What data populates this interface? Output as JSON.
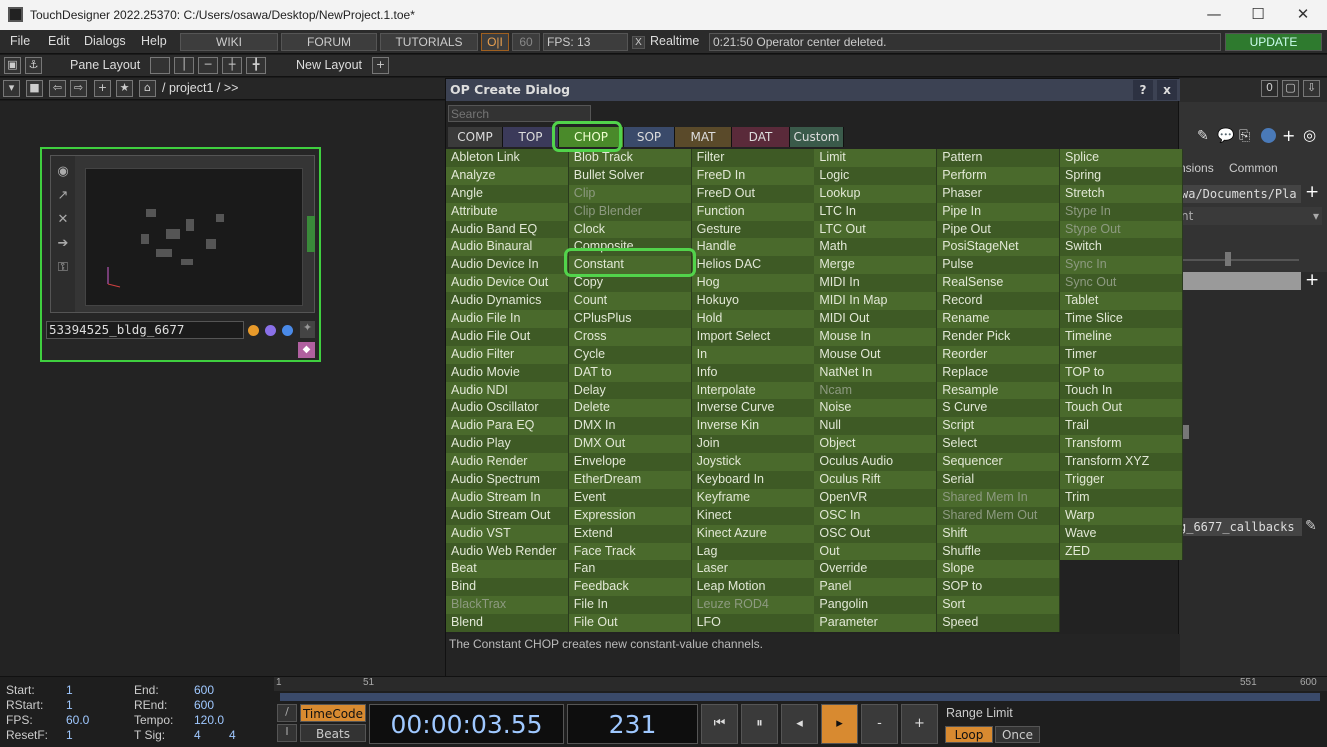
{
  "window": {
    "title": "TouchDesigner 2022.25370: C:/Users/osawa/Desktop/NewProject.1.toe*",
    "min": "—",
    "max": "☐",
    "close": "✕"
  },
  "menubar": {
    "file": "File",
    "edit": "Edit",
    "dialogs": "Dialogs",
    "help": "Help",
    "wiki": "WIKI",
    "forum": "FORUM",
    "tutorials": "TUTORIALS",
    "oi": "O|I",
    "fps_cap": "60",
    "fps_label": "FPS:",
    "fps_value": "13",
    "realtime": "Realtime",
    "message": "0:21:50 Operator center deleted.",
    "update": "UPDATE",
    "realtime_check": "X"
  },
  "toolbar": {
    "pane_layout": "Pane Layout",
    "new_layout": "New Layout",
    "plus": "+"
  },
  "pathbar": {
    "path": "/ project1 / >>"
  },
  "node": {
    "name": "53394525_bldg_6677"
  },
  "dialog": {
    "title": "OP Create Dialog",
    "help": "?",
    "close": "x",
    "search_placeholder": "Search",
    "families": [
      "COMP",
      "TOP",
      "CHOP",
      "SOP",
      "MAT",
      "DAT",
      "Custom"
    ],
    "status": "The Constant CHOP creates new constant-value channels."
  },
  "columns": [
    [
      {
        "n": "Ableton Link"
      },
      {
        "n": "Analyze"
      },
      {
        "n": "Angle"
      },
      {
        "n": "Attribute"
      },
      {
        "n": "Audio Band EQ"
      },
      {
        "n": "Audio Binaural"
      },
      {
        "n": "Audio Device In"
      },
      {
        "n": "Audio Device Out"
      },
      {
        "n": "Audio Dynamics"
      },
      {
        "n": "Audio File In"
      },
      {
        "n": "Audio File Out"
      },
      {
        "n": "Audio Filter"
      },
      {
        "n": "Audio Movie"
      },
      {
        "n": "Audio NDI"
      },
      {
        "n": "Audio Oscillator"
      },
      {
        "n": "Audio Para EQ"
      },
      {
        "n": "Audio Play"
      },
      {
        "n": "Audio Render"
      },
      {
        "n": "Audio Spectrum"
      },
      {
        "n": "Audio Stream In"
      },
      {
        "n": "Audio Stream Out"
      },
      {
        "n": "Audio VST"
      },
      {
        "n": "Audio Web Render"
      },
      {
        "n": "Beat"
      },
      {
        "n": "Bind"
      },
      {
        "n": "BlackTrax",
        "d": 1
      },
      {
        "n": "Blend"
      }
    ],
    [
      {
        "n": "Blob Track"
      },
      {
        "n": "Bullet Solver"
      },
      {
        "n": "Clip",
        "d": 1
      },
      {
        "n": "Clip Blender",
        "d": 1
      },
      {
        "n": "Clock"
      },
      {
        "n": "Composite"
      },
      {
        "n": "Constant"
      },
      {
        "n": "Copy"
      },
      {
        "n": "Count"
      },
      {
        "n": "CPlusPlus"
      },
      {
        "n": "Cross"
      },
      {
        "n": "Cycle"
      },
      {
        "n": "DAT to"
      },
      {
        "n": "Delay"
      },
      {
        "n": "Delete"
      },
      {
        "n": "DMX In"
      },
      {
        "n": "DMX Out"
      },
      {
        "n": "Envelope"
      },
      {
        "n": "EtherDream"
      },
      {
        "n": "Event"
      },
      {
        "n": "Expression"
      },
      {
        "n": "Extend"
      },
      {
        "n": "Face Track"
      },
      {
        "n": "Fan"
      },
      {
        "n": "Feedback"
      },
      {
        "n": "File In"
      },
      {
        "n": "File Out"
      }
    ],
    [
      {
        "n": "Filter"
      },
      {
        "n": "FreeD In"
      },
      {
        "n": "FreeD Out"
      },
      {
        "n": "Function"
      },
      {
        "n": "Gesture"
      },
      {
        "n": "Handle"
      },
      {
        "n": "Helios DAC"
      },
      {
        "n": "Hog"
      },
      {
        "n": "Hokuyo"
      },
      {
        "n": "Hold"
      },
      {
        "n": "Import Select"
      },
      {
        "n": "In"
      },
      {
        "n": "Info"
      },
      {
        "n": "Interpolate"
      },
      {
        "n": "Inverse Curve"
      },
      {
        "n": "Inverse Kin"
      },
      {
        "n": "Join"
      },
      {
        "n": "Joystick"
      },
      {
        "n": "Keyboard In"
      },
      {
        "n": "Keyframe"
      },
      {
        "n": "Kinect"
      },
      {
        "n": "Kinect Azure"
      },
      {
        "n": "Lag"
      },
      {
        "n": "Laser"
      },
      {
        "n": "Leap Motion"
      },
      {
        "n": "Leuze ROD4",
        "d": 1
      },
      {
        "n": "LFO"
      }
    ],
    [
      {
        "n": "Limit"
      },
      {
        "n": "Logic"
      },
      {
        "n": "Lookup"
      },
      {
        "n": "LTC In"
      },
      {
        "n": "LTC Out"
      },
      {
        "n": "Math"
      },
      {
        "n": "Merge"
      },
      {
        "n": "MIDI In"
      },
      {
        "n": "MIDI In Map"
      },
      {
        "n": "MIDI Out"
      },
      {
        "n": "Mouse In"
      },
      {
        "n": "Mouse Out"
      },
      {
        "n": "NatNet In"
      },
      {
        "n": "Ncam",
        "d": 1
      },
      {
        "n": "Noise"
      },
      {
        "n": "Null"
      },
      {
        "n": "Object"
      },
      {
        "n": "Oculus Audio"
      },
      {
        "n": "Oculus Rift"
      },
      {
        "n": "OpenVR"
      },
      {
        "n": "OSC In"
      },
      {
        "n": "OSC Out"
      },
      {
        "n": "Out"
      },
      {
        "n": "Override"
      },
      {
        "n": "Panel"
      },
      {
        "n": "Pangolin"
      },
      {
        "n": "Parameter"
      }
    ],
    [
      {
        "n": "Pattern"
      },
      {
        "n": "Perform"
      },
      {
        "n": "Phaser"
      },
      {
        "n": "Pipe In"
      },
      {
        "n": "Pipe Out"
      },
      {
        "n": "PosiStageNet"
      },
      {
        "n": "Pulse"
      },
      {
        "n": "RealSense"
      },
      {
        "n": "Record"
      },
      {
        "n": "Rename"
      },
      {
        "n": "Render Pick"
      },
      {
        "n": "Reorder"
      },
      {
        "n": "Replace"
      },
      {
        "n": "Resample"
      },
      {
        "n": "S Curve"
      },
      {
        "n": "Script"
      },
      {
        "n": "Select"
      },
      {
        "n": "Sequencer"
      },
      {
        "n": "Serial"
      },
      {
        "n": "Shared Mem In",
        "d": 1
      },
      {
        "n": "Shared Mem Out",
        "d": 1
      },
      {
        "n": "Shift"
      },
      {
        "n": "Shuffle"
      },
      {
        "n": "Slope"
      },
      {
        "n": "SOP to"
      },
      {
        "n": "Sort"
      },
      {
        "n": "Speed"
      }
    ],
    [
      {
        "n": "Splice"
      },
      {
        "n": "Spring"
      },
      {
        "n": "Stretch"
      },
      {
        "n": "Stype In",
        "d": 1
      },
      {
        "n": "Stype Out",
        "d": 1
      },
      {
        "n": "Switch"
      },
      {
        "n": "Sync In",
        "d": 1
      },
      {
        "n": "Sync Out",
        "d": 1
      },
      {
        "n": "Tablet"
      },
      {
        "n": "Time Slice"
      },
      {
        "n": "Timeline"
      },
      {
        "n": "Timer"
      },
      {
        "n": "TOP to"
      },
      {
        "n": "Touch In"
      },
      {
        "n": "Touch Out"
      },
      {
        "n": "Trail"
      },
      {
        "n": "Transform"
      },
      {
        "n": "Transform XYZ"
      },
      {
        "n": "Trigger"
      },
      {
        "n": "Trim"
      },
      {
        "n": "Warp"
      },
      {
        "n": "Wave"
      },
      {
        "n": "ZED"
      }
    ]
  ],
  "right": {
    "badge": "0",
    "tab1": "nsions",
    "tab2": "Common",
    "path": "wa/Documents/Pla",
    "dd": "nt",
    "callback": "g_6677_callbacks"
  },
  "bottom": {
    "start_l": "Start:",
    "start": "1",
    "end_l": "End:",
    "end": "600",
    "rstart_l": "RStart:",
    "rstart": "1",
    "rend_l": "REnd:",
    "rend": "600",
    "fps_l": "FPS:",
    "fps": "60.0",
    "tempo_l": "Tempo:",
    "tempo": "120.0",
    "resetf_l": "ResetF:",
    "resetf": "1",
    "tsig_l": "T Sig:",
    "tsig1": "4",
    "tsig2": "4",
    "timecode": "TimeCode",
    "beats": "Beats",
    "time": "00:00:03.55",
    "frame": "231",
    "range_limit": "Range Limit",
    "loop": "Loop",
    "once": "Once",
    "ruler1": "1",
    "ruler51": "51",
    "ruler551": "551",
    "ruler600": "600",
    "minus": "-",
    "plus": "+"
  }
}
